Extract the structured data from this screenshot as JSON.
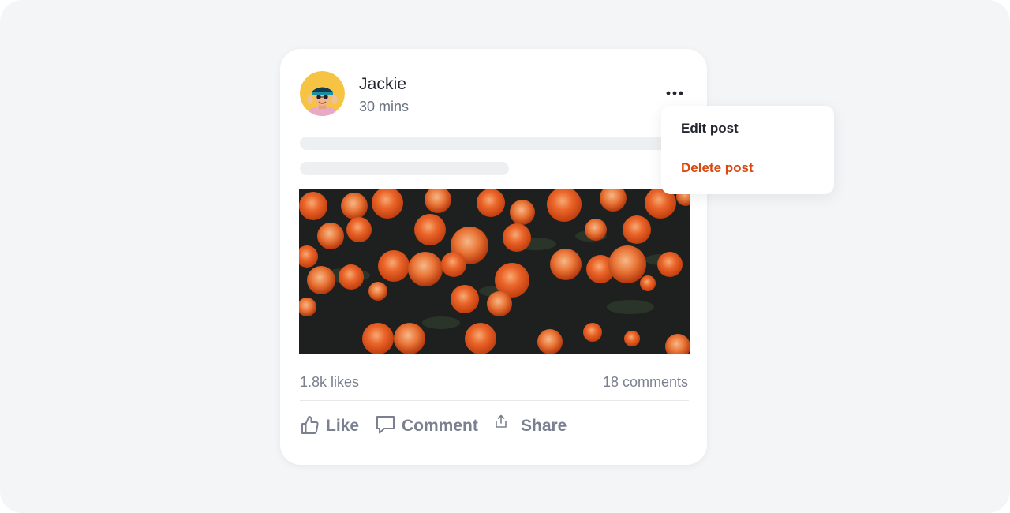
{
  "post": {
    "author": "Jackie",
    "time": "30 mins",
    "avatar_icon": "avatar-photo",
    "image_icon": "marigold-flowers-photo",
    "more_icon": "more-horizontal-icon",
    "likes": "1.8k likes",
    "comments": "18 comments"
  },
  "actions": {
    "like": {
      "label": "Like",
      "icon": "thumbs-up-icon"
    },
    "comment": {
      "label": "Comment",
      "icon": "comment-icon"
    },
    "share": {
      "label": "Share",
      "icon": "share-icon"
    }
  },
  "menu": {
    "items": [
      {
        "label": "Edit post"
      },
      {
        "label": "Delete post"
      }
    ]
  },
  "colors": {
    "background": "#f4f5f7",
    "card": "#ffffff",
    "text_primary": "#1f2430",
    "text_secondary": "#7b8090",
    "danger": "#d9480f",
    "avatar_bg": "#f7c342",
    "flower": "#f2652a"
  }
}
